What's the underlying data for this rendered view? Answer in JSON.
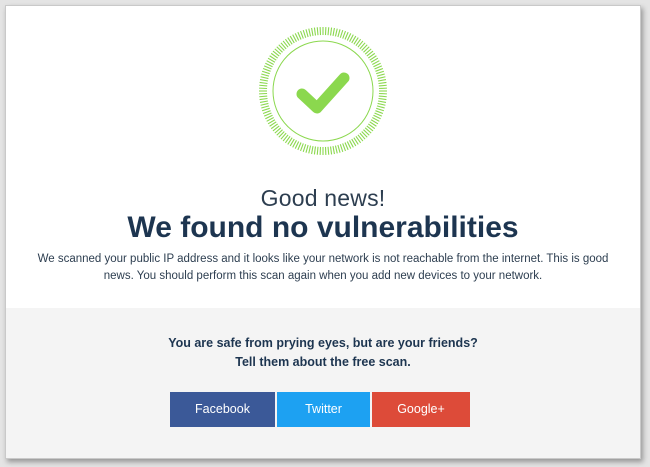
{
  "colors": {
    "success_green": "#8bd84e",
    "facebook": "#3b5998",
    "twitter": "#1da1f2",
    "google_plus": "#dd4b39"
  },
  "result": {
    "icon": "checkmark-icon",
    "subtitle": "Good news!",
    "title": "We found no vulnerabilities",
    "description_line1": "We scanned your public IP address and it looks like your network is not reachable from the internet. This is good",
    "description_line2": "news. You should perform this scan again when you add new devices to your network."
  },
  "share": {
    "prompt_line1": "You are safe from prying eyes, but are your friends?",
    "prompt_line2": "Tell them about the free scan.",
    "facebook_label": "Facebook",
    "twitter_label": "Twitter",
    "google_plus_label": "Google+"
  }
}
